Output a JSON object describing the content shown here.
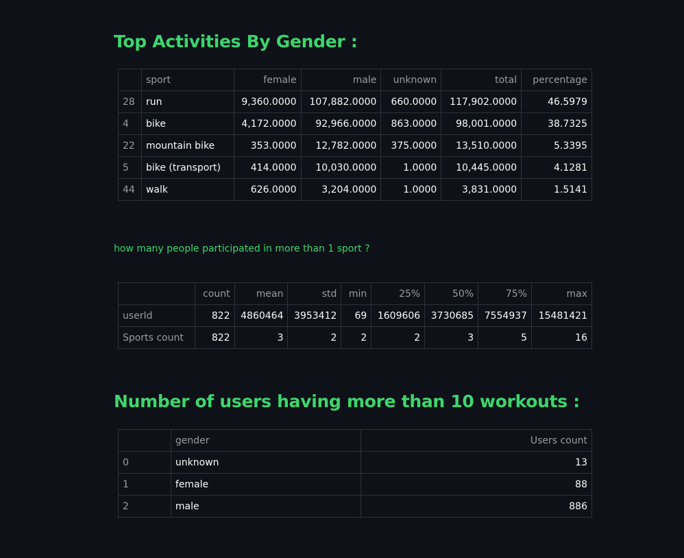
{
  "section1": {
    "title": "Top Activities By Gender :",
    "columns": [
      "",
      "sport",
      "female",
      "male",
      "unknown",
      "total",
      "percentage"
    ],
    "rows": [
      {
        "idx": "28",
        "sport": "run",
        "female": "9,360.0000",
        "male": "107,882.0000",
        "unknown": "660.0000",
        "total": "117,902.0000",
        "percentage": "46.5979"
      },
      {
        "idx": "4",
        "sport": "bike",
        "female": "4,172.0000",
        "male": "92,966.0000",
        "unknown": "863.0000",
        "total": "98,001.0000",
        "percentage": "38.7325"
      },
      {
        "idx": "22",
        "sport": "mountain bike",
        "female": "353.0000",
        "male": "12,782.0000",
        "unknown": "375.0000",
        "total": "13,510.0000",
        "percentage": "5.3395"
      },
      {
        "idx": "5",
        "sport": "bike (transport)",
        "female": "414.0000",
        "male": "10,030.0000",
        "unknown": "1.0000",
        "total": "10,445.0000",
        "percentage": "4.1281"
      },
      {
        "idx": "44",
        "sport": "walk",
        "female": "626.0000",
        "male": "3,204.0000",
        "unknown": "1.0000",
        "total": "3,831.0000",
        "percentage": "1.5141"
      }
    ]
  },
  "section2": {
    "question": "how many people participated in more than 1 sport ?",
    "columns": [
      "",
      "count",
      "mean",
      "std",
      "min",
      "25%",
      "50%",
      "75%",
      "max"
    ],
    "rows": [
      {
        "idx": "userId",
        "count": "822",
        "mean": "4860464",
        "std": "3953412",
        "min": "69",
        "p25": "1609606",
        "p50": "3730685",
        "p75": "7554937",
        "max": "15481421"
      },
      {
        "idx": "Sports count",
        "count": "822",
        "mean": "3",
        "std": "2",
        "min": "2",
        "p25": "2",
        "p50": "3",
        "p75": "5",
        "max": "16"
      }
    ]
  },
  "section3": {
    "title": "Number of users having more than 10 workouts :",
    "columns": [
      "",
      "gender",
      "Users count"
    ],
    "rows": [
      {
        "idx": "0",
        "gender": "unknown",
        "users_count": "13"
      },
      {
        "idx": "1",
        "gender": "female",
        "users_count": "88"
      },
      {
        "idx": "2",
        "gender": "male",
        "users_count": "886"
      }
    ]
  }
}
